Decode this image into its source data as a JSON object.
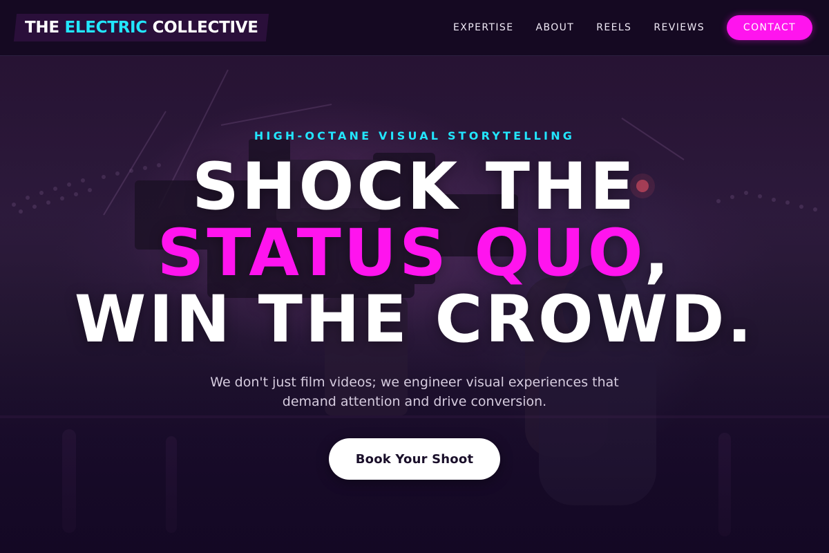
{
  "nav": {
    "logo": {
      "part1": "THE ",
      "accent": "ELECTRIC",
      "part2": " COLLECTIVE"
    },
    "links": [
      {
        "label": "EXPERTISE"
      },
      {
        "label": "ABOUT"
      },
      {
        "label": "REELS"
      },
      {
        "label": "REVIEWS"
      }
    ],
    "contact_label": "CONTACT"
  },
  "hero": {
    "tagline": "HIGH-OCTANE VISUAL STORYTELLING",
    "headline": {
      "line1": "SHOCK THE",
      "line2_highlight": "STATUS QUO",
      "line2_suffix": ",",
      "line3": "WIN THE CROWD."
    },
    "subtext": "We don't just film videos; we engineer visual experiences that demand attention and drive conversion.",
    "cta_label": "Book Your Shoot",
    "background_image": "film-camera-set-photo"
  },
  "colors": {
    "accent_cyan": "#22e6ff",
    "accent_magenta": "#ff14ee",
    "background_dark": "#150922"
  }
}
